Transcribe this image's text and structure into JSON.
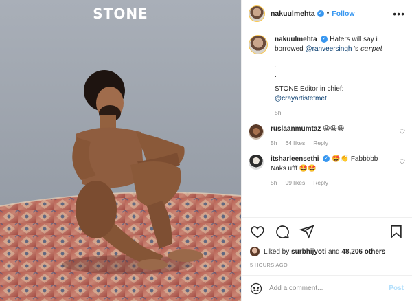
{
  "photo": {
    "brand": "STONE"
  },
  "header": {
    "username": "nakuulmehta",
    "follow_label": "Follow",
    "more_glyph": "•••"
  },
  "caption": {
    "username": "nakuulmehta",
    "text_prefix": "Haters will say i borrowed",
    "mention": "@ranveersingh",
    "text_suffix": "'s",
    "cursive_word": "carpet",
    "dots": [
      ".",
      "."
    ],
    "editor_line": "STONE Editor in chief:",
    "editor_mention": "@crayartistetmet",
    "time": "5h"
  },
  "comments": [
    {
      "username": "ruslaanmumtaz",
      "text": "😀😀😀",
      "time": "5h",
      "likes": "64 likes",
      "reply": "Reply"
    },
    {
      "username": "itsharleensethi",
      "text": "🤩👏 Fabbbbb Naks ufff 🤩🤩",
      "time": "5h",
      "likes": "99 likes",
      "reply": "Reply"
    }
  ],
  "likes_bar": {
    "prefix": "Liked by",
    "user": "surbhijyoti",
    "and": "and",
    "count": "48,206 others"
  },
  "posted_ago": "5 HOURS AGO",
  "add_comment": {
    "placeholder": "Add a comment...",
    "post_label": "Post"
  },
  "icons": {
    "like": "heart-icon",
    "comment": "comment-icon",
    "share": "share-icon",
    "save": "bookmark-icon",
    "emoji": "smiley-icon",
    "verified": "verified-badge-icon",
    "more": "more-options-icon"
  },
  "colors": {
    "link": "#3897f0",
    "mention": "#00376b",
    "muted": "#8e8e8e",
    "post_disabled": "#b2dffc"
  }
}
